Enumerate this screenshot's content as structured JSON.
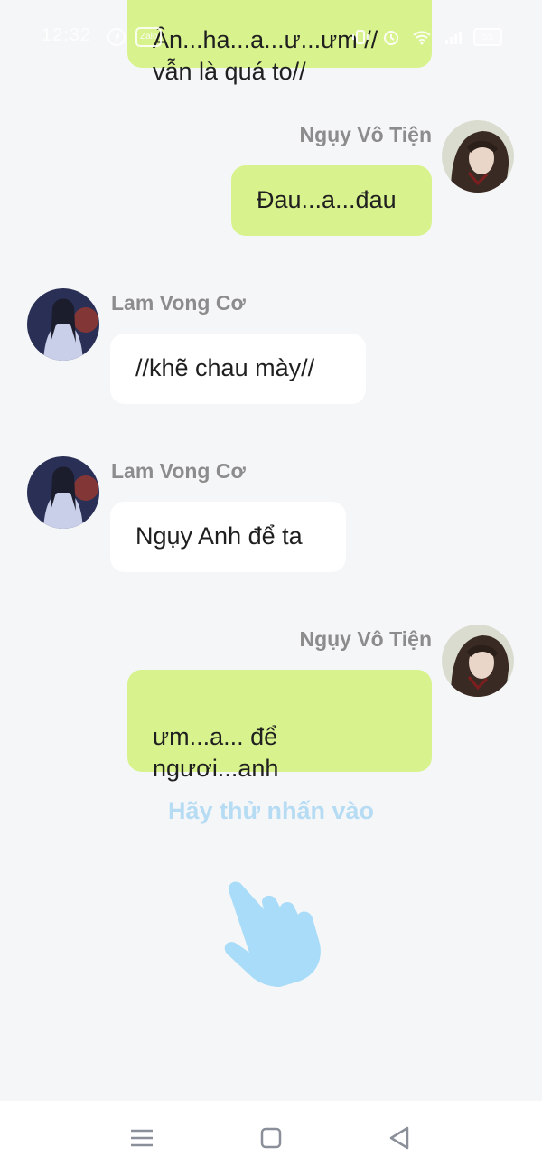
{
  "status_bar": {
    "time": "12:32",
    "app_badge": "Zalo",
    "battery": "55"
  },
  "messages": [
    {
      "sender": "Ngụy Vô Tiện",
      "side": "right",
      "text": "Ân...ha...a...ư...ưm //\nvẫn là quá to//"
    },
    {
      "sender": "Ngụy Vô Tiện",
      "side": "right",
      "text": "Đau...a...đau"
    },
    {
      "sender": "Lam Vong Cơ",
      "side": "left",
      "text": "//khẽ chau mày//"
    },
    {
      "sender": "Lam Vong Cơ",
      "side": "left",
      "text": "Ngụy Anh để ta"
    },
    {
      "sender": "Ngụy Vô Tiện",
      "side": "right",
      "text": "ưm...a... để\nngươi...anh"
    }
  ],
  "hint": "Hãy thử nhấn vào",
  "colors": {
    "bubble_right": "#d8f38d",
    "bubble_left": "#ffffff",
    "background": "#f5f6f8",
    "hint": "#b6dcf4",
    "hand": "#a8dcf8"
  },
  "icons": {
    "hand": "tap-hand-icon",
    "nav_menu": "menu-icon",
    "nav_home": "home-square-icon",
    "nav_back": "back-triangle-icon"
  }
}
